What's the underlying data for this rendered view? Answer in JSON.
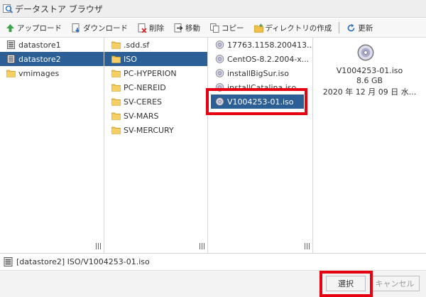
{
  "window": {
    "title": "データストア ブラウザ"
  },
  "toolbar": {
    "upload": "アップロード",
    "download": "ダウンロード",
    "delete": "削除",
    "move": "移動",
    "copy": "コピー",
    "create_dir": "ディレクトリの作成",
    "refresh": "更新"
  },
  "datastores": [
    {
      "name": "datastore1",
      "selected": false
    },
    {
      "name": "datastore2",
      "selected": true
    },
    {
      "name": "vmimages",
      "selected": false
    }
  ],
  "folders": [
    {
      "name": ".sdd.sf",
      "selected": false
    },
    {
      "name": "ISO",
      "selected": true
    },
    {
      "name": "PC-HYPERION",
      "selected": false
    },
    {
      "name": "PC-NEREID",
      "selected": false
    },
    {
      "name": "SV-CERES",
      "selected": false
    },
    {
      "name": "SV-MARS",
      "selected": false
    },
    {
      "name": "SV-MERCURY",
      "selected": false
    }
  ],
  "files": [
    {
      "name": "17763.1158.200413...",
      "selected": false
    },
    {
      "name": "CentOS-8.2.2004-x...",
      "selected": false
    },
    {
      "name": "installBigSur.iso",
      "selected": false
    },
    {
      "name": "installCatalina.iso",
      "selected": false
    },
    {
      "name": "V1004253-01.iso",
      "selected": true
    }
  ],
  "preview": {
    "name": "V1004253-01.iso",
    "size": "8.6 GB",
    "date": "2020 年 12 月 09 日 水..."
  },
  "status": {
    "path": "[datastore2] ISO/V1004253-01.iso"
  },
  "buttons": {
    "select": "選択",
    "cancel": "キャンセル"
  },
  "colors": {
    "selection": "#2c5f95",
    "highlight": "#e60012",
    "folder": "#f0c04a"
  }
}
